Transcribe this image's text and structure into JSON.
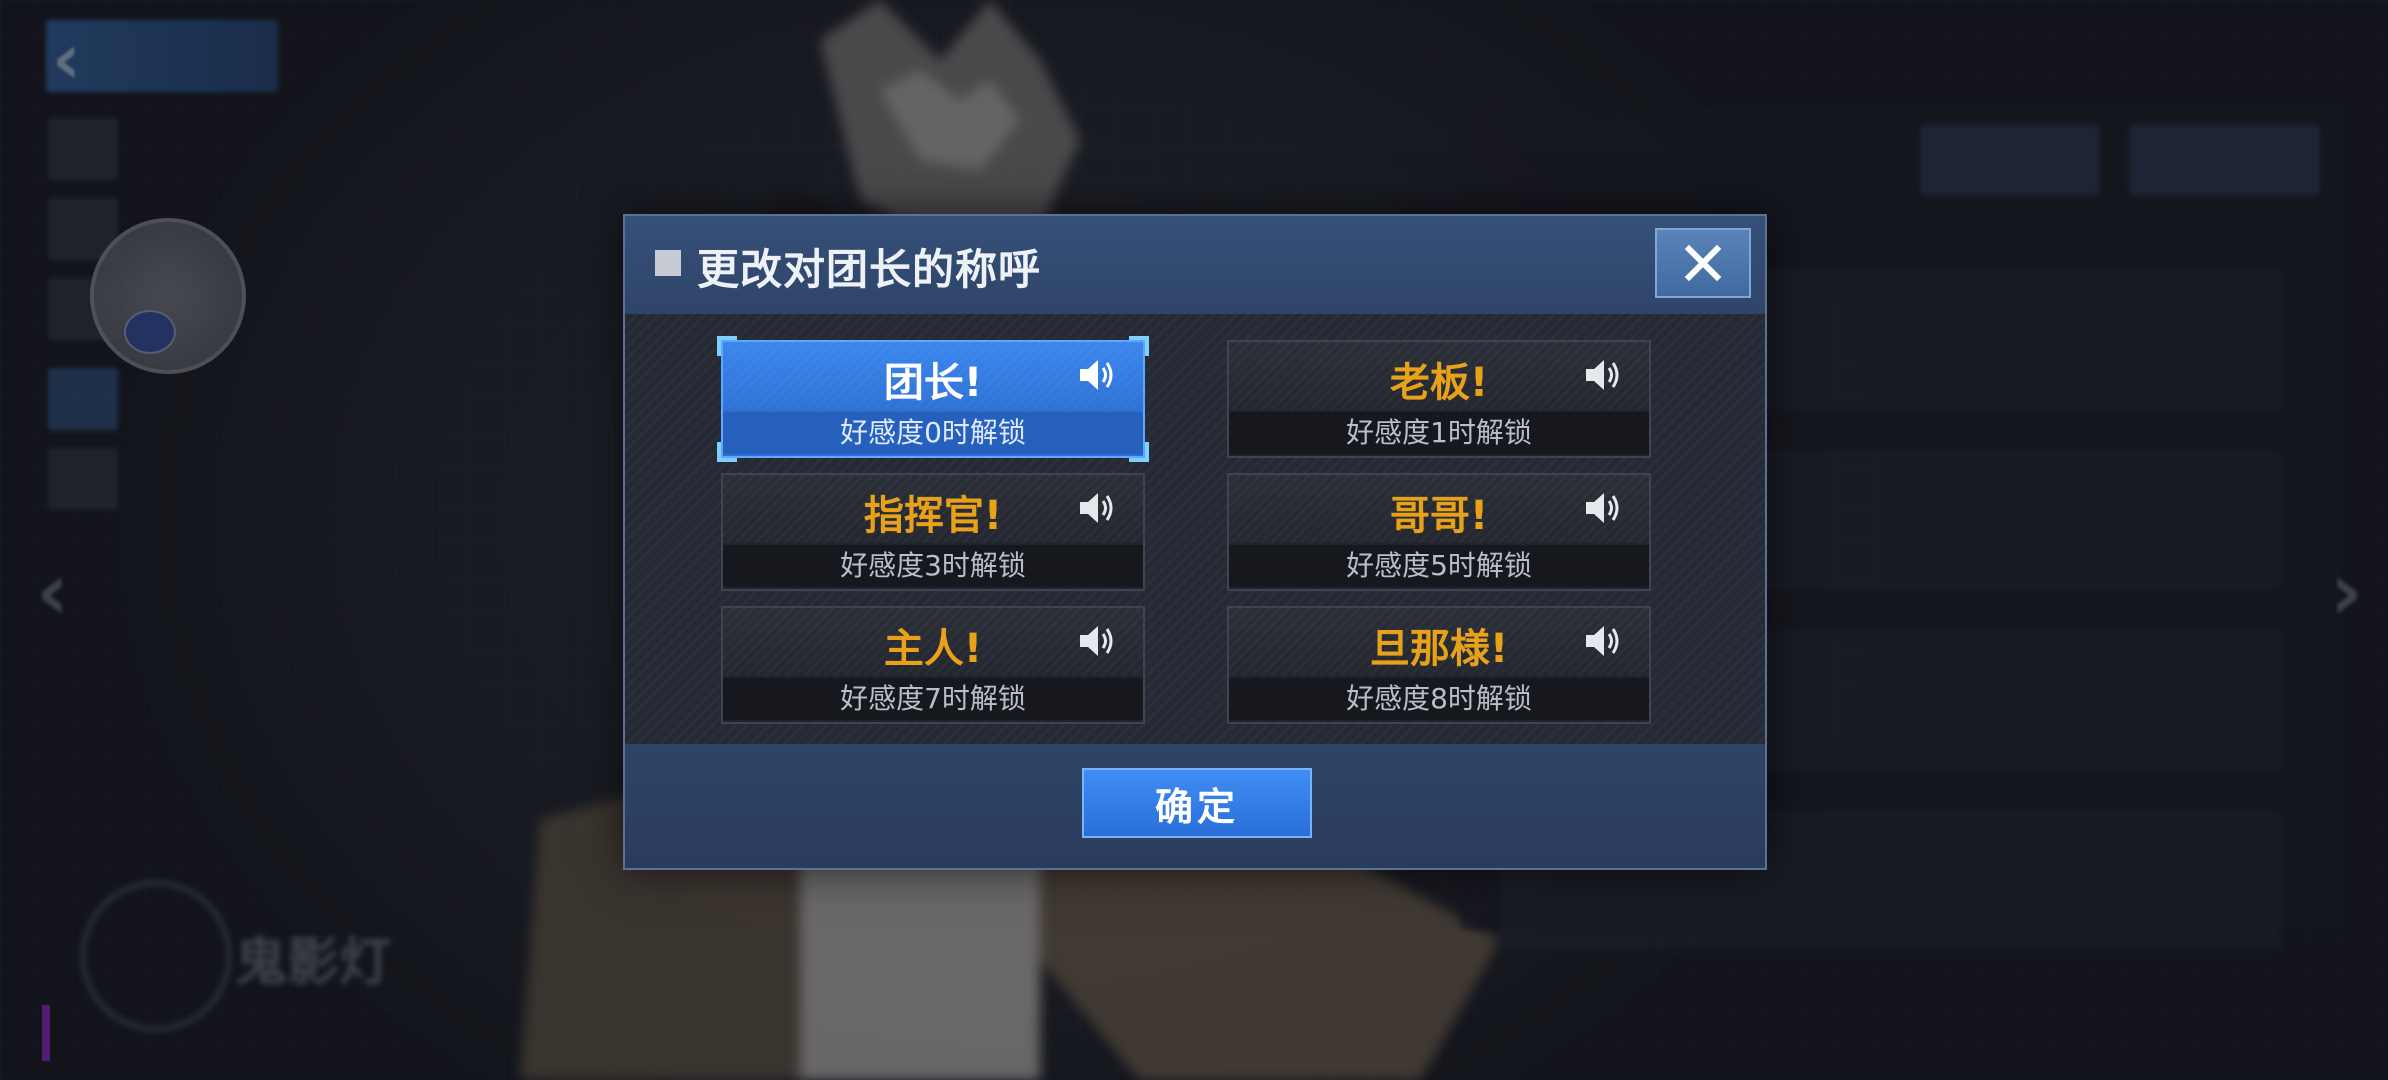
{
  "background": {
    "character_name": "鬼影灯"
  },
  "dialog": {
    "title": "更改对团长的称呼",
    "close_icon": "close-x-icon",
    "options": [
      {
        "name": "团长!",
        "unlock": "好感度0时解锁",
        "selected": true
      },
      {
        "name": "老板!",
        "unlock": "好感度1时解锁",
        "selected": false
      },
      {
        "name": "指挥官!",
        "unlock": "好感度3时解锁",
        "selected": false
      },
      {
        "name": "哥哥!",
        "unlock": "好感度5时解锁",
        "selected": false
      },
      {
        "name": "主人!",
        "unlock": "好感度7时解锁",
        "selected": false
      },
      {
        "name": "旦那様!",
        "unlock": "好感度8时解锁",
        "selected": false
      }
    ],
    "confirm_label": "确定"
  },
  "colors": {
    "accent_blue": "#2d6fd1",
    "name_gold": "#e8a21a",
    "header_bg": "#36507a"
  }
}
